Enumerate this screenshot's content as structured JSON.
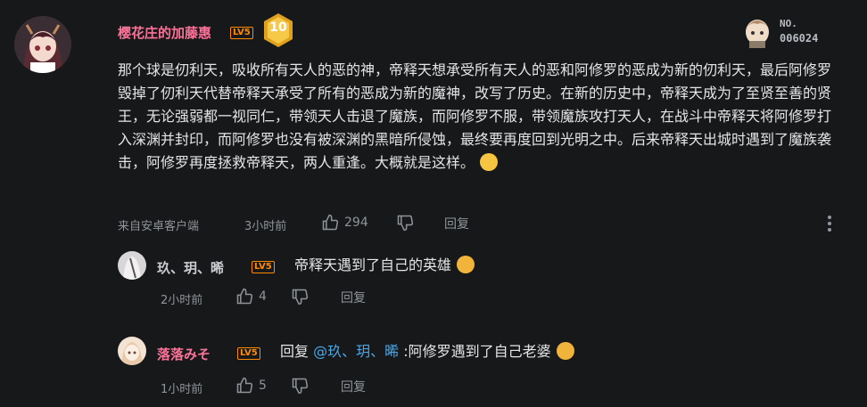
{
  "main_comment": {
    "username": "樱花庄的加藤惠",
    "level": "LV5",
    "medal_number": "10",
    "fan_card_prefix": "NO.",
    "fan_card_number": "006024",
    "text": "那个球是仞利天，吸收所有天人的恶的神，帝释天想承受所有天人的恶和阿修罗的恶成为新的仞利天，最后阿修罗毁掉了仞利天代替帝释天承受了所有的恶成为新的魔神，改写了历史。在新的历史中，帝释天成为了至贤至善的贤王，无论强弱都一视同仁，带领天人击退了魔族，而阿修罗不服，带领魔族攻打天人，在战斗中帝释天将阿修罗打入深渊并封印，而阿修罗也没有被深渊的黑暗所侵蚀，最终要再度回到光明之中。后来帝释天出城时遇到了魔族袭击，阿修罗再度拯救帝释天，两人重逢。大概就是这样。",
    "source": "来自安卓客户端",
    "time": "3小时前",
    "likes": "294",
    "reply_label": "回复"
  },
  "replies": [
    {
      "username": "玖、玥、晞",
      "level": "LV5",
      "text": "帝释天遇到了自己的英雄",
      "time": "2小时前",
      "likes": "4",
      "reply_label": "回复"
    },
    {
      "username": "落落みそ",
      "level": "LV5",
      "reply_prefix": "回复",
      "mention": "@玖、玥、晞",
      "text": ":阿修罗遇到了自己老婆",
      "time": "1小时前",
      "likes": "5",
      "reply_label": "回复"
    }
  ],
  "colors": {
    "vip_pink": "#fb7299",
    "level_orange": "#ff8a00",
    "mention_blue": "#4aa8e8"
  }
}
